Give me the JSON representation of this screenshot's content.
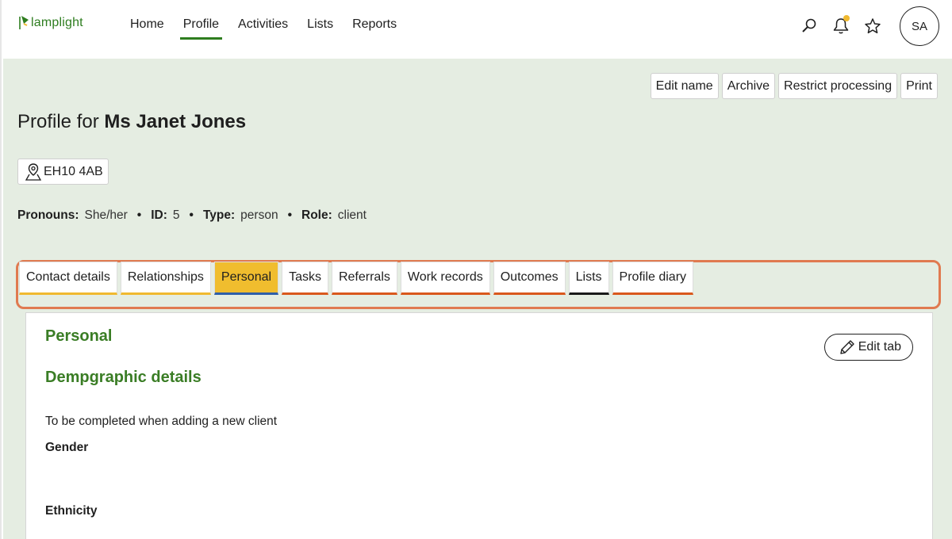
{
  "app": {
    "logo_text": "lamplight",
    "brand_color": "#2e7d1f",
    "accent_color": "#f0b930"
  },
  "nav": {
    "items": [
      {
        "label": "Home",
        "active": false
      },
      {
        "label": "Profile",
        "active": true
      },
      {
        "label": "Activities",
        "active": false
      },
      {
        "label": "Lists",
        "active": false
      },
      {
        "label": "Reports",
        "active": false
      }
    ]
  },
  "header": {
    "icons": [
      "search-icon",
      "bell-icon",
      "star-icon"
    ],
    "has_notification": true,
    "avatar_initials": "SA"
  },
  "actions": {
    "edit_name": "Edit name",
    "archive": "Archive",
    "restrict": "Restrict processing",
    "print": "Print"
  },
  "profile": {
    "title_prefix": "Profile for",
    "name": "Ms Janet Jones",
    "postcode": "EH10 4AB",
    "pronouns_label": "Pronouns:",
    "pronouns": "She/her",
    "id_label": "ID:",
    "id": "5",
    "type_label": "Type:",
    "type": "person",
    "role_label": "Role:",
    "role": "client"
  },
  "tabs": [
    {
      "label": "Contact details",
      "color": "yellow"
    },
    {
      "label": "Relationships",
      "color": "yellow"
    },
    {
      "label": "Personal",
      "color": "active"
    },
    {
      "label": "Tasks",
      "color": "orange"
    },
    {
      "label": "Referrals",
      "color": "orange"
    },
    {
      "label": "Work records",
      "color": "orange"
    },
    {
      "label": "Outcomes",
      "color": "orange"
    },
    {
      "label": "Lists",
      "color": "dark"
    },
    {
      "label": "Profile diary",
      "color": "orange"
    }
  ],
  "panel": {
    "heading": "Personal",
    "edit_tab": "Edit tab",
    "section_heading": "Dempgraphic details",
    "description": "To be completed when adding a new client",
    "gender_label": "Gender",
    "ethnicity_label": "Ethnicity"
  }
}
